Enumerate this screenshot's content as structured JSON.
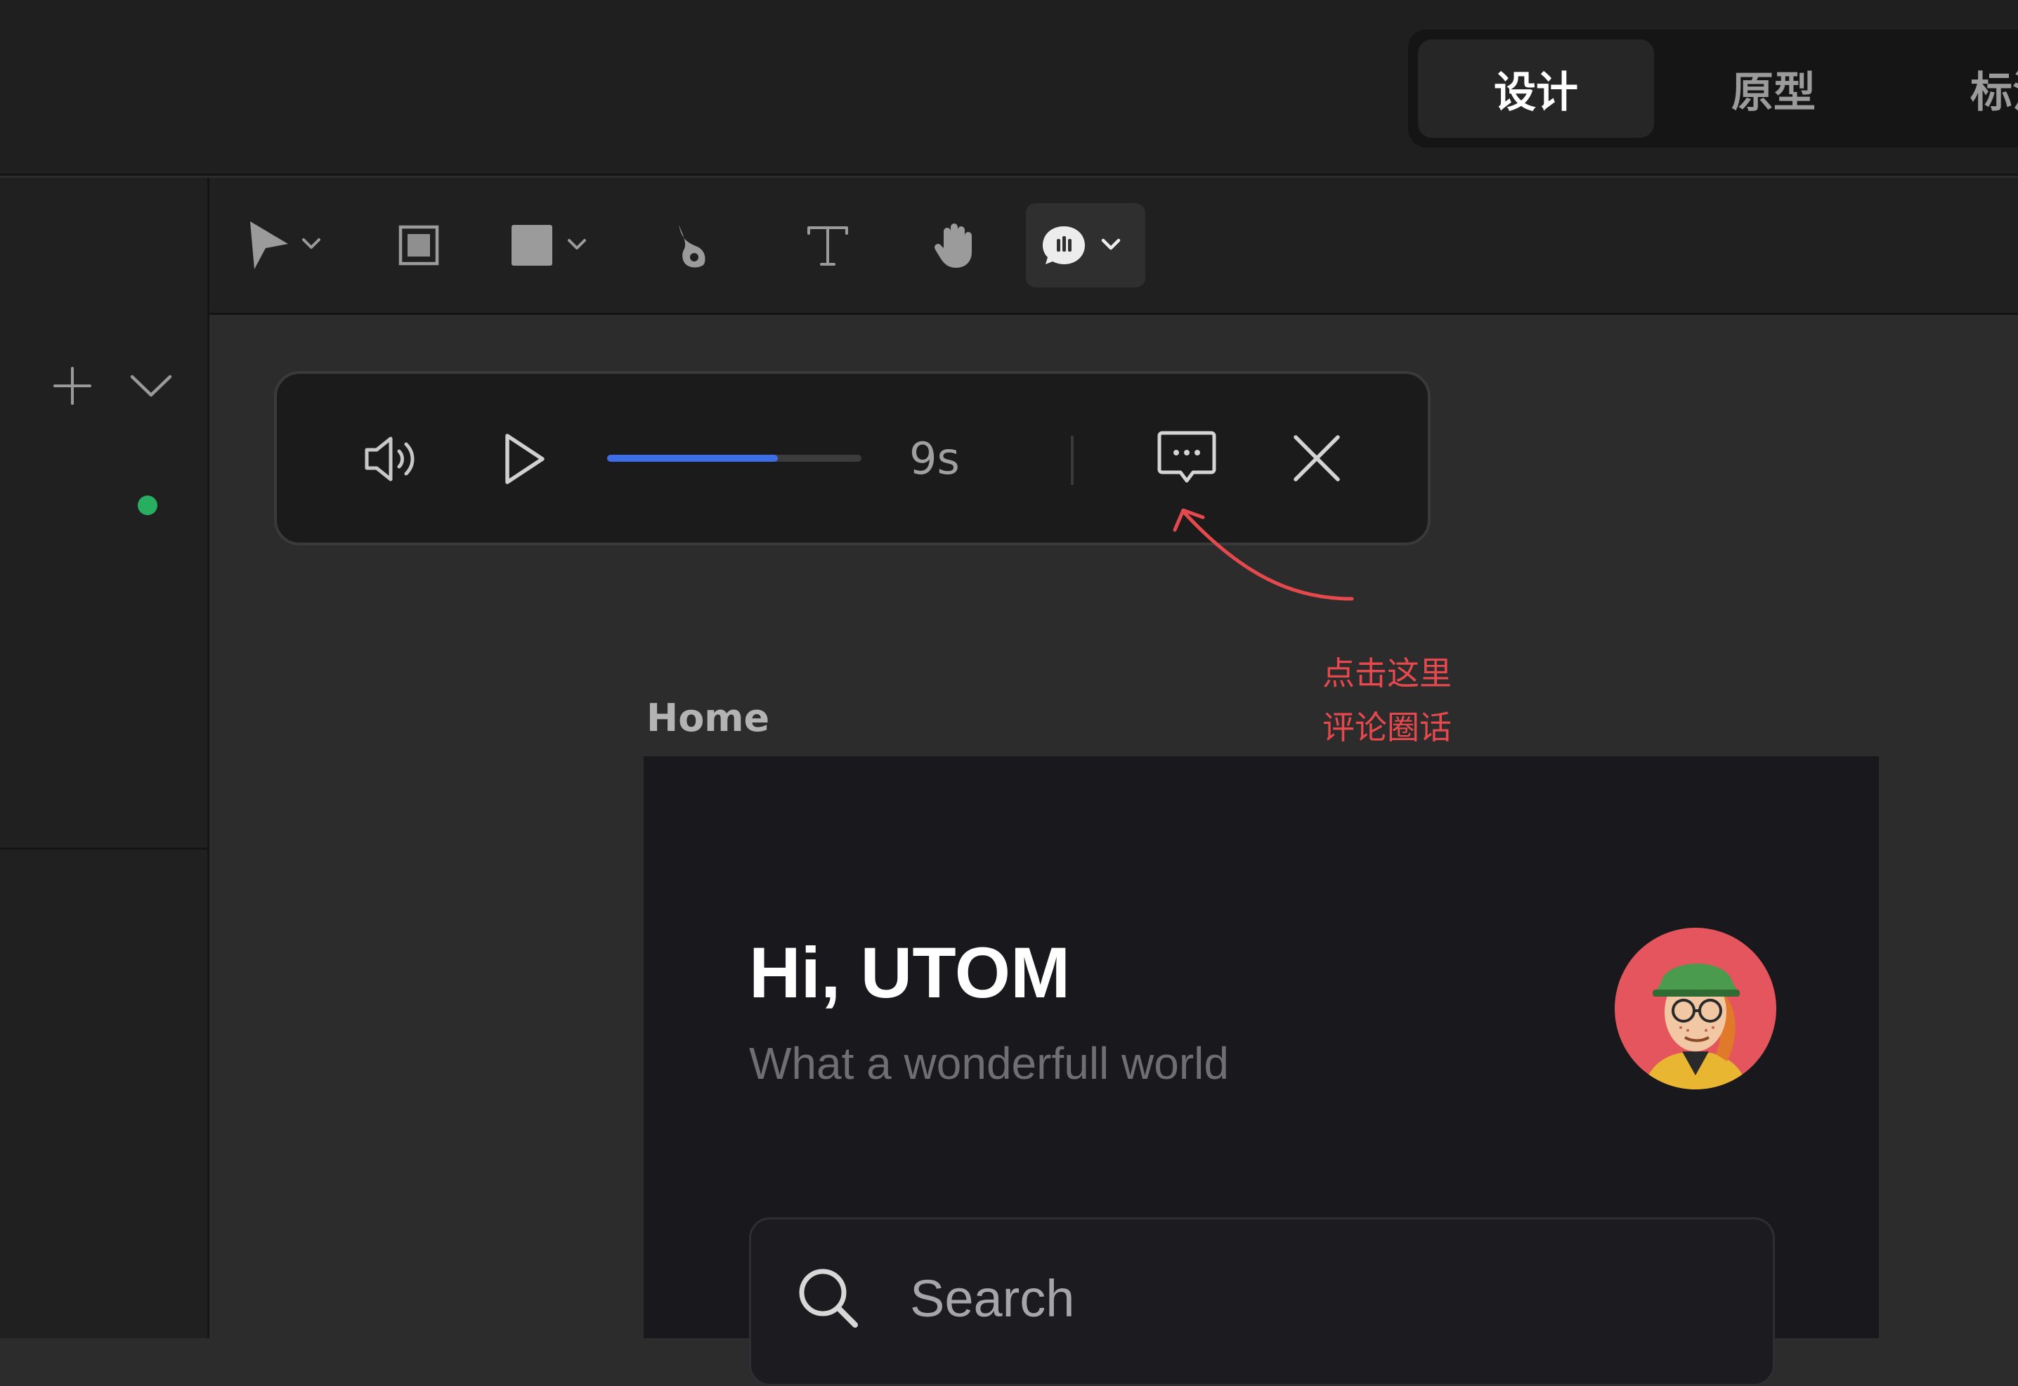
{
  "top_bar": {
    "mode_tabs": [
      {
        "label": "设计",
        "active": true
      },
      {
        "label": "原型",
        "active": false
      },
      {
        "label": "标注",
        "active": false
      }
    ]
  },
  "toolbar": {
    "tools": [
      {
        "name": "move-tool",
        "icon": "cursor-arrow-icon",
        "has_menu": true
      },
      {
        "name": "frame-tool",
        "icon": "frame-icon",
        "has_menu": false
      },
      {
        "name": "shape-tool",
        "icon": "rectangle-icon",
        "has_menu": true
      },
      {
        "name": "pen-tool",
        "icon": "pen-nib-icon",
        "has_menu": false
      },
      {
        "name": "text-tool",
        "icon": "text-icon",
        "has_menu": false
      },
      {
        "name": "hand-tool",
        "icon": "hand-icon",
        "has_menu": false
      },
      {
        "name": "voice-comment-tool",
        "icon": "voice-bubble-icon",
        "has_menu": true,
        "active": true
      }
    ]
  },
  "left_panel": {
    "add_icon": "plus-icon",
    "collapse_icon": "chevron-down-icon",
    "status_color": "#27ae60"
  },
  "player": {
    "time": "9s",
    "progress": 0.67,
    "progress_color": "#3d6ee8",
    "icons": [
      "volume-icon",
      "play-icon",
      "comment-icon",
      "close-icon"
    ]
  },
  "annotation": {
    "line1": "点击这里",
    "line2": "评论圈话",
    "color": "#e5494d"
  },
  "frame": {
    "label": "Home",
    "greeting": "Hi, UTOM",
    "subtitle": "What a wonderfull world",
    "search_placeholder": "Search",
    "avatar_color": "#e5555e"
  }
}
